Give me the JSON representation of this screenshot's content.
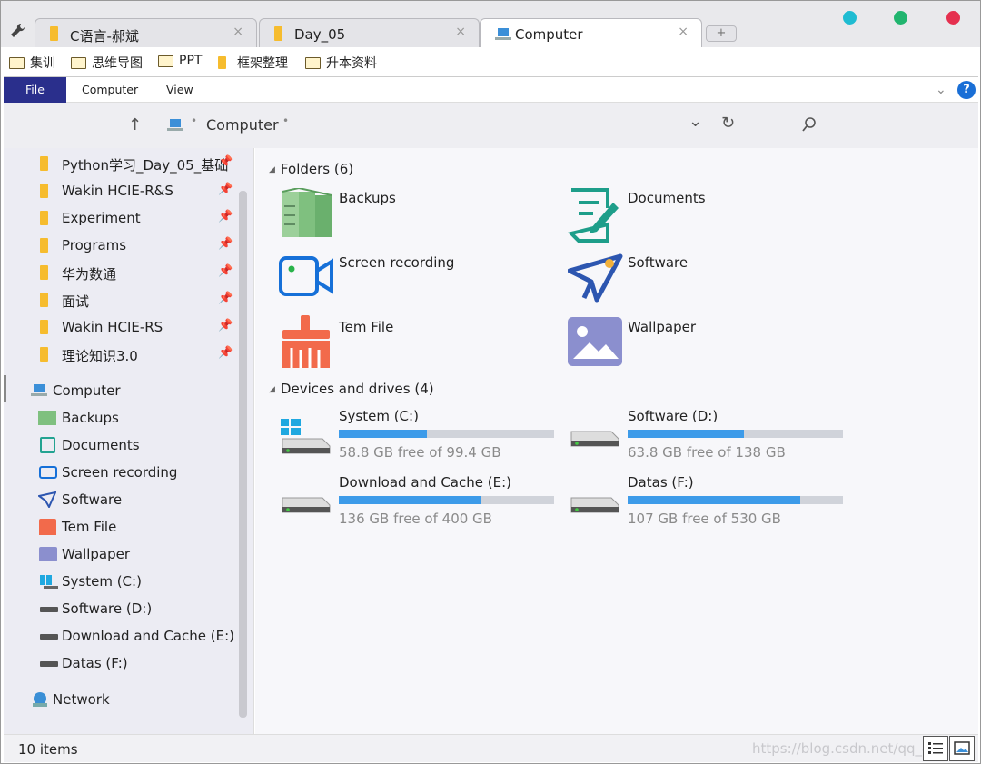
{
  "tabs": [
    {
      "label": "C语言-郝斌",
      "close": "×"
    },
    {
      "label": "Day_05",
      "close": "×"
    },
    {
      "label": "Computer",
      "close": "×"
    }
  ],
  "new_tab": "+",
  "window_dots": {
    "colors": [
      "#1fbcd2",
      "#21b56f",
      "#e5304f"
    ]
  },
  "bookmarks": [
    "集训",
    "思维导图",
    "PPT",
    "框架整理",
    "升本资料"
  ],
  "ribbon": {
    "tabs": [
      "File",
      "Computer",
      "View"
    ],
    "help": "?"
  },
  "address": {
    "up": "↑",
    "path": "Computer",
    "dropdown": "⌄",
    "refresh": "↻"
  },
  "sidebar": {
    "pinned": [
      "Python学习_Day_05_基础",
      "Wakin HCIE-R&S",
      "Experiment",
      "Programs",
      "华为数通",
      "面试",
      "Wakin HCIE-RS",
      "理论知识3.0"
    ],
    "computer_label": "Computer",
    "items": [
      "Backups",
      "Documents",
      "Screen recording",
      "Software",
      "Tem File",
      "Wallpaper",
      "System (C:)",
      "Software (D:)",
      "Download and Cache (E:)",
      "Datas (F:)"
    ],
    "network_label": "Network"
  },
  "main": {
    "folders_header": "Folders (6)",
    "folders": [
      {
        "name": "Backups",
        "icon": "backups-icon"
      },
      {
        "name": "Documents",
        "icon": "documents-icon"
      },
      {
        "name": "Screen recording",
        "icon": "screen-recording-icon"
      },
      {
        "name": "Software",
        "icon": "software-icon"
      },
      {
        "name": "Tem File",
        "icon": "tem-file-icon"
      },
      {
        "name": "Wallpaper",
        "icon": "wallpaper-icon"
      }
    ],
    "drives_header": "Devices and drives (4)",
    "drives": [
      {
        "name": "System (C:)",
        "free": "58.8 GB free of 99.4 GB",
        "used_fraction": 0.41
      },
      {
        "name": "Software (D:)",
        "free": "63.8 GB free of 138 GB",
        "used_fraction": 0.54
      },
      {
        "name": "Download and Cache (E:)",
        "free": "136 GB free of 400 GB",
        "used_fraction": 0.66
      },
      {
        "name": "Datas (F:)",
        "free": "107 GB free of 530 GB",
        "used_fraction": 0.8
      }
    ]
  },
  "status": {
    "items_count": "10 items",
    "watermark": "https://blog.csdn.net/qq_45"
  }
}
